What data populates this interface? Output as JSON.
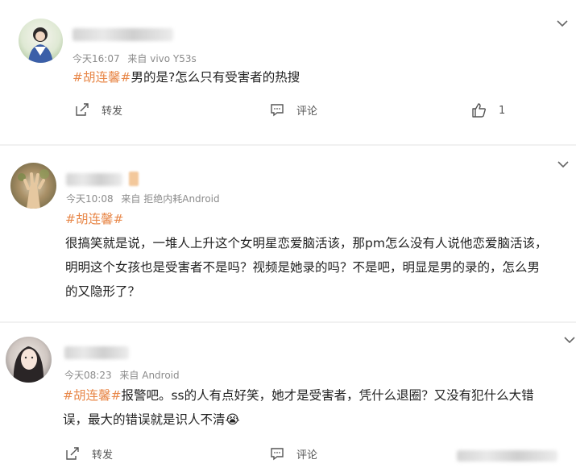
{
  "posts": [
    {
      "time": "今天16:07",
      "source": "来自 vivo Y53s",
      "tag": "#胡连馨#",
      "text": "男的是?怎么只有受害者的热搜",
      "actions": {
        "repost": "转发",
        "comment": "评论",
        "like_count": "1"
      }
    },
    {
      "time": "今天10:08",
      "source": "来自 拒绝内耗Android",
      "tag": "#胡连馨#",
      "lines": [
        "很搞笑就是说，一堆人上升这个女明星恋爱脑活该，那pm怎么没有人说他恋爱脑活该，",
        "明明这个女孩也是受害者不是吗？视频是她录的吗？不是吧，明显是男的录的，怎么男",
        "的又隐形了？"
      ]
    },
    {
      "time": "今天08:23",
      "source": "来自 Android",
      "tag": "#胡连馨#",
      "line1": "报警吧。ss的人有点好笑，她才是受害者，凭什么退圈？又没有犯什么大错",
      "line2": "误，最大的错误就是识人不清",
      "emoji": "😭",
      "actions": {
        "repost": "转发",
        "comment": "评论"
      }
    }
  ],
  "icons": {
    "expand": "chevron-down-icon",
    "repost": "repost-icon",
    "comment": "comment-icon",
    "like": "thumbs-up-icon"
  },
  "colors": {
    "tag": "#e8884a",
    "meta": "#8b8b8b",
    "text": "#222222"
  }
}
